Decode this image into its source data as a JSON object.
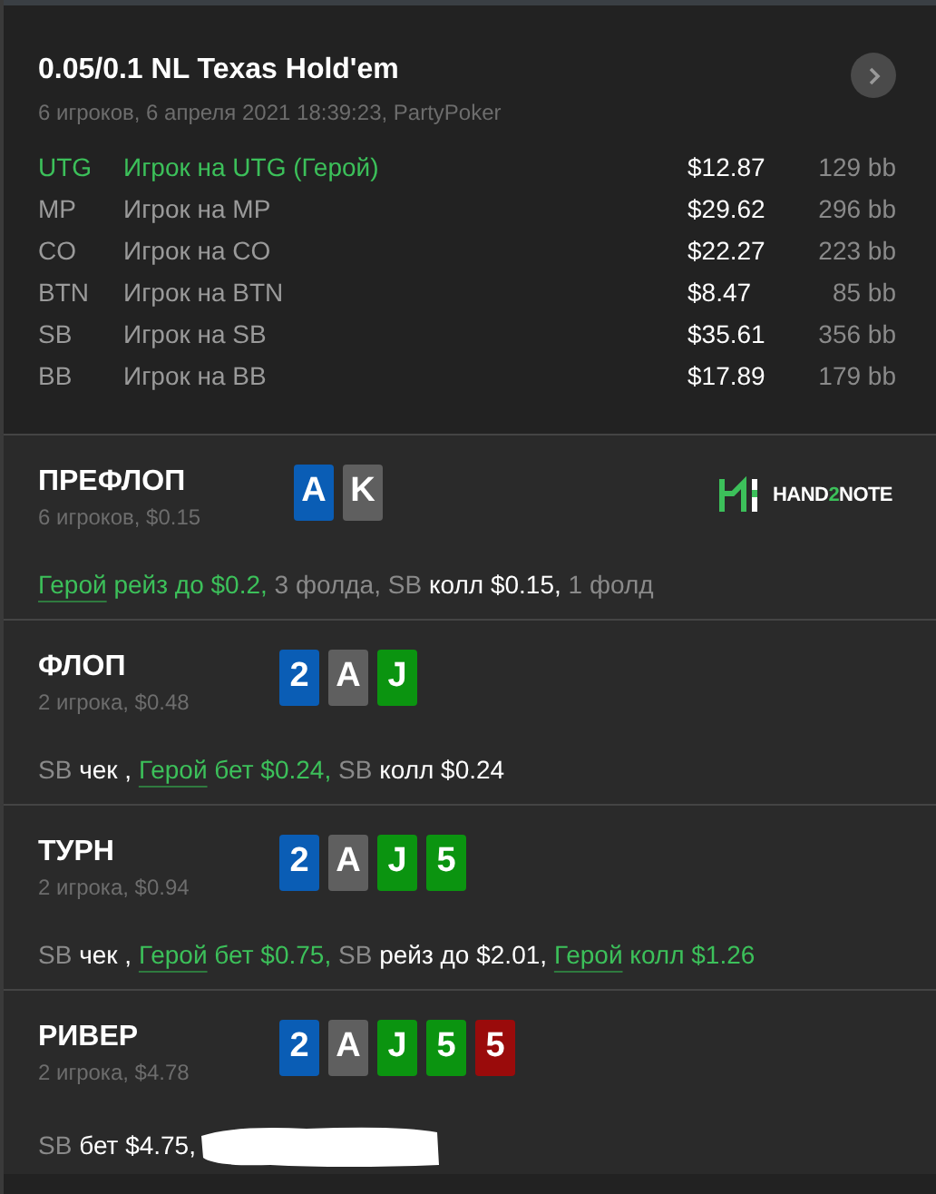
{
  "header": {
    "title": "0.05/0.1 NL Texas Hold'em",
    "subtitle": "6 игроков, 6 апреля 2021 18:39:23, PartyPoker"
  },
  "players": [
    {
      "position": "UTG",
      "name": "Игрок на UTG (Герой)",
      "hero": true,
      "stack": "$12.87",
      "bb": "129 bb"
    },
    {
      "position": "MP",
      "name": "Игрок на MP",
      "hero": false,
      "stack": "$29.62",
      "bb": "296 bb"
    },
    {
      "position": "CO",
      "name": "Игрок на CO",
      "hero": false,
      "stack": "$22.27",
      "bb": "223 bb"
    },
    {
      "position": "BTN",
      "name": "Игрок на BTN",
      "hero": false,
      "stack": "$8.47",
      "bb": "85 bb"
    },
    {
      "position": "SB",
      "name": "Игрок на SB",
      "hero": false,
      "stack": "$35.61",
      "bb": "356 bb"
    },
    {
      "position": "BB",
      "name": "Игрок на BB",
      "hero": false,
      "stack": "$17.89",
      "bb": "179 bb"
    }
  ],
  "logo": {
    "parts": [
      "HAND",
      "2",
      "NOTE"
    ]
  },
  "streets": [
    {
      "title": "ПРЕФЛОП",
      "info": "6 игроков, $0.15",
      "logo": true,
      "redacted": false,
      "cards": [
        {
          "rank": "A",
          "color": "#0a5db5"
        },
        {
          "rank": "K",
          "color": "#5f5f5f"
        }
      ],
      "actions": [
        {
          "kind": "hero",
          "actor": "Герой",
          "text": "рейз до $0.2,"
        },
        {
          "kind": "fold",
          "text": "3 фолда,"
        },
        {
          "kind": "player",
          "actor": "SB",
          "text": "колл $0.15,"
        },
        {
          "kind": "fold",
          "text": "1 фолд"
        }
      ]
    },
    {
      "title": "ФЛОП",
      "info": "2 игрока, $0.48",
      "logo": false,
      "redacted": false,
      "cards": [
        {
          "rank": "2",
          "color": "#0a5db5"
        },
        {
          "rank": "A",
          "color": "#5f5f5f"
        },
        {
          "rank": "J",
          "color": "#0b9410"
        }
      ],
      "actions": [
        {
          "kind": "player",
          "actor": "SB",
          "text": "чек ,"
        },
        {
          "kind": "hero",
          "actor": "Герой",
          "text": "бет $0.24,"
        },
        {
          "kind": "player",
          "actor": "SB",
          "text": "колл $0.24"
        }
      ]
    },
    {
      "title": "ТУРН",
      "info": "2 игрока, $0.94",
      "logo": false,
      "redacted": false,
      "cards": [
        {
          "rank": "2",
          "color": "#0a5db5"
        },
        {
          "rank": "A",
          "color": "#5f5f5f"
        },
        {
          "rank": "J",
          "color": "#0b9410"
        },
        {
          "rank": "5",
          "color": "#0b9410"
        }
      ],
      "actions": [
        {
          "kind": "player",
          "actor": "SB",
          "text": "чек ,"
        },
        {
          "kind": "hero",
          "actor": "Герой",
          "text": "бет $0.75,"
        },
        {
          "kind": "player",
          "actor": "SB",
          "text": "рейз до $2.01,"
        },
        {
          "kind": "hero",
          "actor": "Герой",
          "text": "колл $1.26"
        }
      ]
    },
    {
      "title": "РИВЕР",
      "info": "2 игрока, $4.78",
      "logo": false,
      "redacted": true,
      "cards": [
        {
          "rank": "2",
          "color": "#0a5db5"
        },
        {
          "rank": "A",
          "color": "#5f5f5f"
        },
        {
          "rank": "J",
          "color": "#0b9410"
        },
        {
          "rank": "5",
          "color": "#0b9410"
        },
        {
          "rank": "5",
          "color": "#9a0b0b"
        }
      ],
      "actions": [
        {
          "kind": "player",
          "actor": "SB",
          "text": "бет $4.75,"
        }
      ]
    }
  ]
}
